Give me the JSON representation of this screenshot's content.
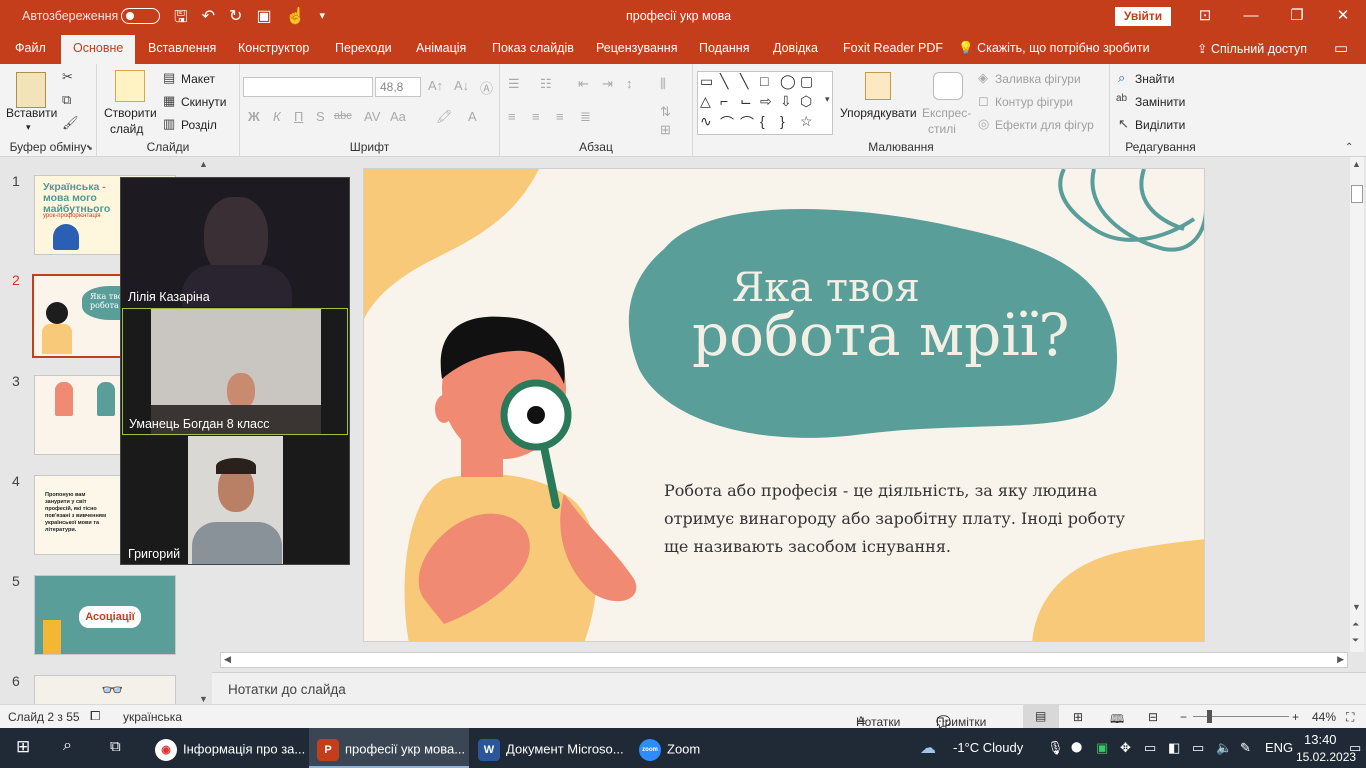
{
  "titlebar": {
    "autosave": "Автозбереження",
    "doc_title": "професії укр мова",
    "signin": "Увійти"
  },
  "tabs": [
    "Файл",
    "Основне",
    "Вставлення",
    "Конструктор",
    "Переходи",
    "Анімація",
    "Показ слайдів",
    "Рецензування",
    "Подання",
    "Довідка",
    "Foxit Reader PDF"
  ],
  "tellme": "Скажіть, що потрібно зробити",
  "share": "Спільний доступ",
  "ribbon": {
    "clipboard": {
      "paste": "Вставити",
      "label": "Буфер обміну"
    },
    "slides": {
      "new_slide_1": "Створити",
      "new_slide_2": "слайд",
      "layout": "Макет",
      "reset": "Скинути",
      "section": "Розділ",
      "label": "Слайди"
    },
    "font": {
      "size": "48,8",
      "bold": "Ж",
      "italic": "К",
      "underline": "П",
      "shadow": "S",
      "strike": "abc",
      "label": "Шрифт"
    },
    "paragraph": {
      "label": "Абзац"
    },
    "drawing": {
      "arrange": "Упорядкувати",
      "quick_styles_1": "Експрес-",
      "quick_styles_2": "стилі",
      "fill": "Заливка фігури",
      "outline": "Контур фігури",
      "effects": "Ефекти для фігур",
      "label": "Малювання"
    },
    "editing": {
      "find": "Знайти",
      "replace": "Замінити",
      "select": "Виділити",
      "label": "Редагування"
    }
  },
  "thumbnails": {
    "numbers": [
      "1",
      "2",
      "3",
      "4",
      "5",
      "6"
    ],
    "t1_title": "Українська - мова мого майбутнього",
    "t1_sub": "урок-профорієнтація",
    "t2_title": "Яка твоя робота мрії?",
    "t4_text": "Пропоную вам занурити у світ професій, які тісно пов'язані з вивченням української мови та літератури.",
    "t5_title": "Асоціації"
  },
  "zoom": {
    "participants": [
      "Лілія Казаріна",
      "Уманець Богдан 8 класс",
      "Григорий"
    ]
  },
  "slide": {
    "title_line1": "Яка твоя",
    "title_line2": "робота мрії?",
    "body": "Робота або професія - це діяльність, за яку людина отримує винагороду або заробітну плату. Іноді роботу ще називають засобом існування."
  },
  "notes_placeholder": "Нотатки до слайда",
  "status": {
    "slide": "Слайд 2 з 55",
    "language": "українська",
    "notes": "Нотатки",
    "comments": "Примітки",
    "zoom": "44%"
  },
  "taskbar": {
    "apps": [
      "Інформація про за...",
      "професії укр мова...",
      "Документ Microso...",
      "Zoom"
    ],
    "weather": "-1°C  Cloudy",
    "lang": "ENG",
    "time": "13:40",
    "date": "15.02.2023"
  },
  "colors": {
    "accent": "#c43e1c",
    "teal": "#5a9e9a",
    "peach": "#f8c978",
    "skin": "#f08a72"
  }
}
